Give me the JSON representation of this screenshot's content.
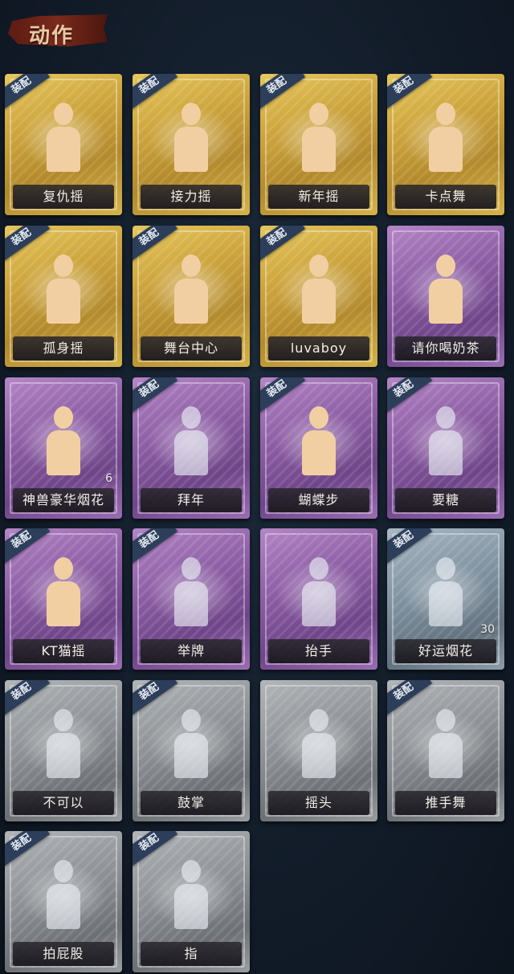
{
  "header": {
    "title": "动作"
  },
  "equip_badge_label": "装配",
  "colors": {
    "gold": "#cda43c",
    "purple": "#8b5ca3",
    "blue": "#7d8f9d",
    "gray": "#8b8f93",
    "badge": "#2c3e5a"
  },
  "actions": [
    {
      "label": "复仇摇",
      "rarity": "gold",
      "equipped": true,
      "icon": "dance-pose-icon",
      "count": ""
    },
    {
      "label": "接力摇",
      "rarity": "gold",
      "equipped": true,
      "icon": "dance-pose-icon",
      "count": ""
    },
    {
      "label": "新年摇",
      "rarity": "gold",
      "equipped": true,
      "icon": "dance-pose-icon",
      "count": ""
    },
    {
      "label": "卡点舞",
      "rarity": "gold",
      "equipped": true,
      "icon": "dance-pose-icon",
      "count": ""
    },
    {
      "label": "孤身摇",
      "rarity": "gold",
      "equipped": true,
      "icon": "dance-pose-icon",
      "count": ""
    },
    {
      "label": "舞台中心",
      "rarity": "gold",
      "equipped": true,
      "icon": "dance-pose-icon",
      "count": ""
    },
    {
      "label": "luvaboy",
      "rarity": "gold",
      "equipped": true,
      "icon": "dance-pose-icon",
      "count": ""
    },
    {
      "label": "请你喝奶茶",
      "rarity": "purple",
      "equipped": false,
      "icon": "milk-tea-sign-icon",
      "count": ""
    },
    {
      "label": "神兽豪华烟花",
      "rarity": "purple",
      "equipped": false,
      "icon": "fireworks-icon",
      "count": "6"
    },
    {
      "label": "拜年",
      "rarity": "purple",
      "equipped": true,
      "icon": "bow-greeting-icon",
      "count": ""
    },
    {
      "label": "蝴蝶步",
      "rarity": "purple",
      "equipped": true,
      "icon": "butterfly-step-icon",
      "count": ""
    },
    {
      "label": "要糖",
      "rarity": "purple",
      "equipped": true,
      "icon": "ask-candy-icon",
      "count": ""
    },
    {
      "label": "KT猫摇",
      "rarity": "purple",
      "equipped": true,
      "icon": "dance-pose-icon",
      "count": ""
    },
    {
      "label": "举牌",
      "rarity": "purple",
      "equipped": true,
      "icon": "hold-sign-icon",
      "count": ""
    },
    {
      "label": "抬手",
      "rarity": "purple",
      "equipped": false,
      "icon": "raise-hand-icon",
      "count": ""
    },
    {
      "label": "好运烟花",
      "rarity": "blue",
      "equipped": true,
      "icon": "firework-canister-icon",
      "count": "30"
    },
    {
      "label": "不可以",
      "rarity": "gray",
      "equipped": true,
      "icon": "finger-wag-icon",
      "count": ""
    },
    {
      "label": "鼓掌",
      "rarity": "gray",
      "equipped": true,
      "icon": "clap-icon",
      "count": ""
    },
    {
      "label": "摇头",
      "rarity": "gray",
      "equipped": false,
      "icon": "shake-head-icon",
      "count": ""
    },
    {
      "label": "推手舞",
      "rarity": "gray",
      "equipped": true,
      "icon": "push-hand-dance-icon",
      "count": ""
    },
    {
      "label": "拍屁股",
      "rarity": "gray",
      "equipped": true,
      "icon": "pat-butt-icon",
      "count": ""
    },
    {
      "label": "指",
      "rarity": "gray",
      "equipped": true,
      "icon": "point-icon",
      "count": ""
    }
  ]
}
